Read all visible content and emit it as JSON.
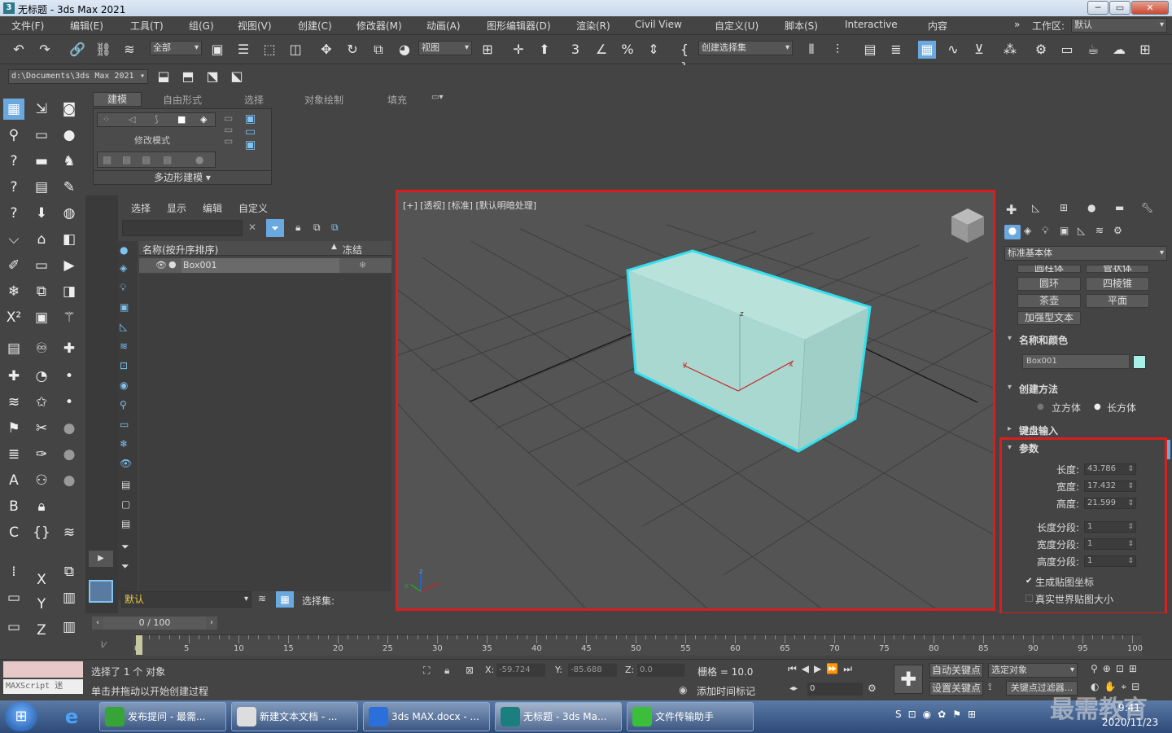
{
  "window": {
    "title": "无标题 - 3ds Max 2021"
  },
  "menu": [
    "文件(F)",
    "编辑(E)",
    "工具(T)",
    "组(G)",
    "视图(V)",
    "创建(C)",
    "修改器(M)",
    "动画(A)",
    "图形编辑器(D)",
    "渲染(R)",
    "Civil View",
    "自定义(U)",
    "脚本(S)",
    "Interactive",
    "内容"
  ],
  "workspace": {
    "label": "工作区:",
    "value": "默认"
  },
  "toolbar": {
    "filter": "全部",
    "view": "视图",
    "selection_set": "创建选择集"
  },
  "path": {
    "project": "d:\\Documents\\3ds Max 2021"
  },
  "ribbon": {
    "tabs": [
      "建模",
      "自由形式",
      "选择",
      "对象绘制",
      "填充"
    ],
    "active_tab": "建模",
    "group_label": "修改模式",
    "poly_label": "多边形建模"
  },
  "scene_explorer": {
    "menu": [
      "选择",
      "显示",
      "编辑",
      "自定义"
    ],
    "col_name": "名称(按升序排序)",
    "col_freeze": "冻结",
    "rows": [
      {
        "name": "Box001"
      }
    ],
    "layer": "默认",
    "selset_label": "选择集:"
  },
  "viewport": {
    "label": "[+] [透视] [标准] [默认明暗处理]"
  },
  "command_panel": {
    "category": "标准基本体",
    "buttons": [
      "圆柱体",
      "管状体",
      "圆环",
      "四棱锥",
      "茶壶",
      "平面",
      "加强型文本"
    ],
    "rollouts": {
      "name_color": "名称和颜色",
      "object_name": "Box001",
      "object_color": "#a8f0ea",
      "creation_method": "创建方法",
      "cube": "立方体",
      "box": "长方体",
      "keyboard": "键盘输入",
      "params": "参数"
    },
    "params": [
      {
        "label": "长度:",
        "value": "43.786"
      },
      {
        "label": "宽度:",
        "value": "17.432"
      },
      {
        "label": "高度:",
        "value": "21.599"
      },
      {
        "label": "长度分段:",
        "value": "1"
      },
      {
        "label": "宽度分段:",
        "value": "1"
      },
      {
        "label": "高度分段:",
        "value": "1"
      }
    ],
    "gen_map": "生成贴图坐标",
    "real_world": "真实世界贴图大小"
  },
  "timeline": {
    "frame": "0 / 100",
    "ticks": [
      "0",
      "5",
      "10",
      "15",
      "20",
      "25",
      "30",
      "35",
      "40",
      "45",
      "50",
      "55",
      "60",
      "65",
      "70",
      "75",
      "80",
      "85",
      "90",
      "95",
      "100"
    ]
  },
  "status": {
    "maxscript": "MAXScript 迷",
    "selected": "选择了 1 个 对象",
    "prompt": "单击并拖动以开始创建过程",
    "x_label": "X:",
    "x": "-59.724",
    "y_label": "Y:",
    "y": "-85.688",
    "z_label": "Z:",
    "z": "0.0",
    "grid": "栅格 = 10.0",
    "add_tag": "添加时间标记",
    "auto_key": "自动关键点",
    "selected_obj": "选定对象",
    "set_key": "设置关键点",
    "key_filter": "关键点过滤器...",
    "frame_field": "0"
  },
  "taskbar": {
    "items": [
      "发布提问 - 最需...",
      "新建文本文档 - ...",
      "3ds MAX.docx - ...",
      "无标题 - 3ds Ma...",
      "文件传输助手"
    ],
    "time": "9:41",
    "date": "2020/11/23",
    "watermark": "最需教育"
  },
  "colors": {
    "accent_red": "#d81e1e",
    "box": "#a8d8d0",
    "box_edge": "#33e0f0",
    "active_blue": "#6aa8e0"
  }
}
